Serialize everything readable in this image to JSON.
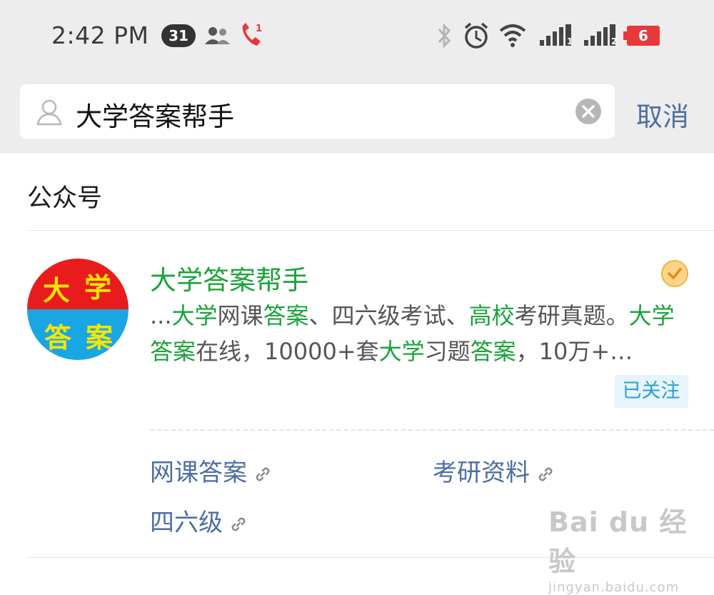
{
  "status_bar": {
    "time": "2:42 PM",
    "notification_count": "31",
    "battery_level": "6",
    "sim_labels": [
      "1",
      "2"
    ]
  },
  "search": {
    "query": "大学答案帮手",
    "cancel_label": "取消"
  },
  "section": {
    "title": "公众号"
  },
  "account": {
    "name": "大学答案帮手",
    "avatar_chars": [
      "大",
      "学",
      "答",
      "案"
    ],
    "description_segments": [
      {
        "text": "...",
        "hl": false
      },
      {
        "text": "大学",
        "hl": true
      },
      {
        "text": "网课",
        "hl": false
      },
      {
        "text": "答案",
        "hl": true
      },
      {
        "text": "、四六级考试、",
        "hl": false
      },
      {
        "text": "高校",
        "hl": true
      },
      {
        "text": "考研真题。",
        "hl": false
      },
      {
        "text": "大学答案",
        "hl": true
      },
      {
        "text": "在线，10000+套",
        "hl": false
      },
      {
        "text": "大学",
        "hl": true
      },
      {
        "text": "习题",
        "hl": false
      },
      {
        "text": "答案",
        "hl": true
      },
      {
        "text": "，10万+…",
        "hl": false
      }
    ],
    "follow_status": "已关注",
    "links": [
      "网课答案",
      "考研资料",
      "四六级"
    ]
  },
  "watermark": {
    "brand": "Bai du 经验",
    "url": "jingyan.baidu.com"
  },
  "colors": {
    "highlight_green": "#1aa33a",
    "link_blue": "#4d6ea3",
    "follow_blue": "#2f9cd3",
    "follow_bg": "#e6f4fb",
    "battery_red": "#e8383b",
    "avatar_red": "#e81c1c",
    "avatar_blue": "#1aa6e3",
    "avatar_yellow": "#f5e600"
  }
}
